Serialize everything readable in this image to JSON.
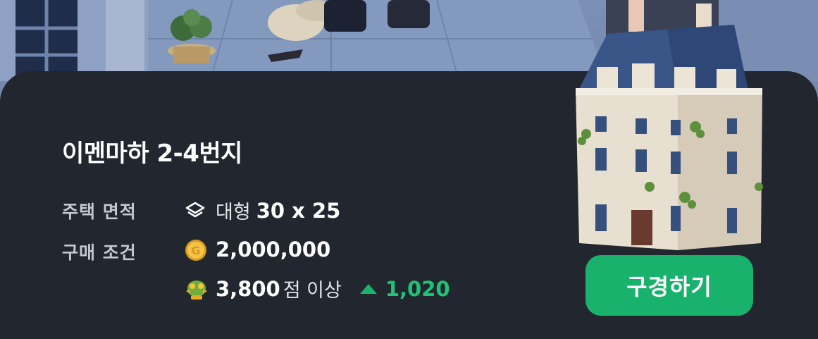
{
  "address": "이멘마하 2-4번지",
  "area": {
    "label": "주택 면적",
    "size_word": "대형",
    "dimensions": "30 x 25",
    "icon": "layers-icon"
  },
  "purchase": {
    "label": "구매 조건",
    "gold": "2,000,000",
    "gold_icon": "gold-coin-icon",
    "score": "3,800",
    "score_suffix": "점 이상",
    "score_icon": "frog-trophy-icon",
    "score_gap": "1,020",
    "gap_icon": "up-arrow-icon"
  },
  "button": {
    "label": "구경하기"
  },
  "colors": {
    "panel": "#22262f",
    "accent": "#19b26c"
  }
}
